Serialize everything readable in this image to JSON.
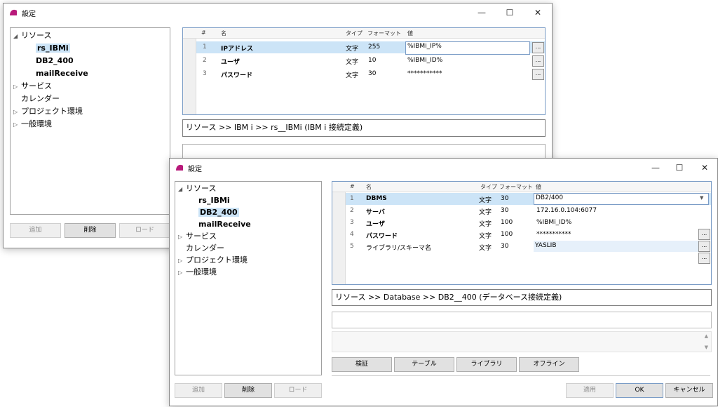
{
  "back": {
    "title": "設定",
    "controls": [
      "—",
      "☐",
      "✕"
    ],
    "tree": {
      "resources": "リソース",
      "children": [
        "rs_IBMi",
        "DB2_400",
        "mailReceive"
      ],
      "services": "サービス",
      "calendar": "カレンダー",
      "project": "プロジェクト環境",
      "general": "一般環境"
    },
    "grid": {
      "headers": {
        "num": "#",
        "name": "名",
        "type": "タイプ",
        "format": "フォーマット",
        "value": "値"
      },
      "rows": [
        {
          "num": "1",
          "name": "IPアドレス",
          "type": "文字",
          "format": "255",
          "value": "%IBMi_IP%"
        },
        {
          "num": "2",
          "name": "ユーザ",
          "type": "文字",
          "format": "10",
          "value": "%IBMi_ID%"
        },
        {
          "num": "3",
          "name": "パスワード",
          "type": "文字",
          "format": "30",
          "value": "***********"
        }
      ]
    },
    "path": "リソース >> IBM i >> rs__IBMi (IBM i 接続定義)",
    "buttons": {
      "add": "追加",
      "delete": "削除",
      "load": "ロード"
    }
  },
  "front": {
    "title": "設定",
    "controls": [
      "—",
      "☐",
      "✕"
    ],
    "tree": {
      "resources": "リソース",
      "children": [
        "rs_IBMi",
        "DB2_400",
        "mailReceive"
      ],
      "services": "サービス",
      "calendar": "カレンダー",
      "project": "プロジェクト環境",
      "general": "一般環境"
    },
    "grid": {
      "headers": {
        "num": "#",
        "name": "名",
        "type": "タイプ",
        "format": "フォーマット",
        "value": "値"
      },
      "rows": [
        {
          "num": "1",
          "name": "DBMS",
          "type": "文字",
          "format": "30",
          "value": "DB2/400"
        },
        {
          "num": "2",
          "name": "サーバ",
          "type": "文字",
          "format": "30",
          "value": "172.16.0.104:6077"
        },
        {
          "num": "3",
          "name": "ユーザ",
          "type": "文字",
          "format": "100",
          "value": "%IBMi_ID%"
        },
        {
          "num": "4",
          "name": "パスワード",
          "type": "文字",
          "format": "100",
          "value": "***********"
        },
        {
          "num": "5",
          "name": "ライブラリ/スキーマ名",
          "type": "文字",
          "format": "30",
          "value": "YASLIB"
        }
      ]
    },
    "path": "リソース >> Database >> DB2__400 (データベース接続定義)",
    "action_buttons": {
      "verify": "検証",
      "table": "テーブル",
      "library": "ライブラリ",
      "offline": "オフライン"
    },
    "buttons": {
      "add": "追加",
      "delete": "削除",
      "load": "ロード",
      "apply": "適用",
      "ok": "OK",
      "cancel": "キャンセル"
    }
  },
  "colors": {
    "selection": "#cce4f7",
    "accent": "#7a9cc6",
    "icon": "#b8197a"
  }
}
